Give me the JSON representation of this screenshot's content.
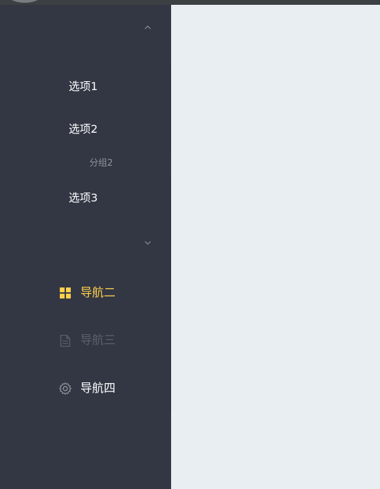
{
  "sidebar": {
    "submenu1": {
      "items": [
        {
          "label": "选项1"
        },
        {
          "label": "选项2"
        },
        {
          "label": "选项3"
        }
      ],
      "group_title": "分组2",
      "expanded": true
    },
    "submenu2": {
      "expanded": false
    },
    "nav": [
      {
        "label": "导航二",
        "icon": "grid-icon",
        "state": "active"
      },
      {
        "label": "导航三",
        "icon": "document-icon",
        "state": "disabled"
      },
      {
        "label": "导航四",
        "icon": "gear-icon",
        "state": "normal"
      }
    ]
  },
  "colors": {
    "sidebar_bg": "#333744",
    "main_bg": "#e9eef3",
    "active_text": "#ffd04b",
    "disabled_text": "#5b606c",
    "normal_text": "#ffffff"
  }
}
